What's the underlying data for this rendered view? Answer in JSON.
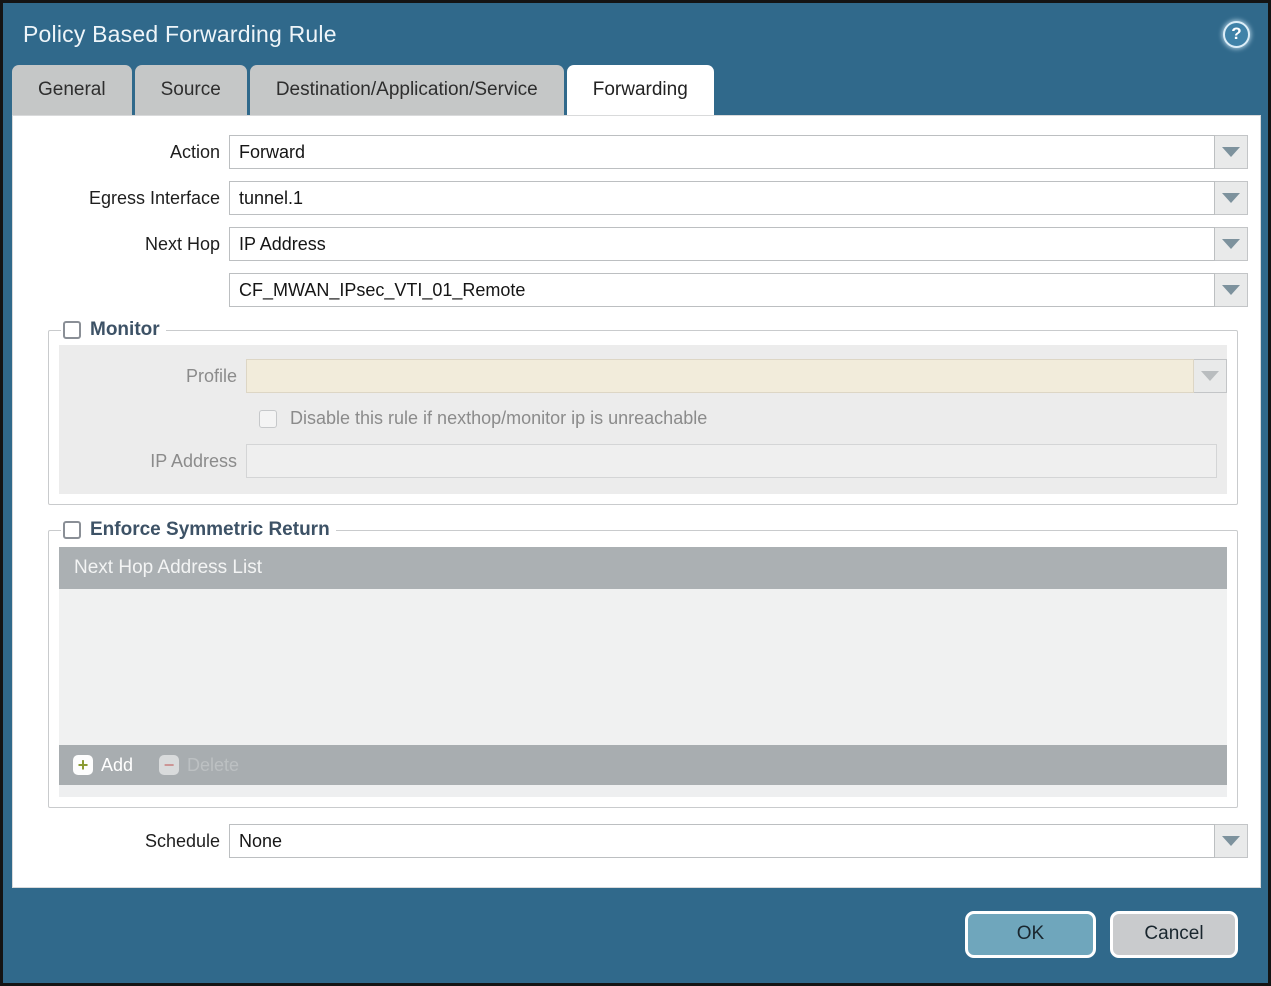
{
  "dialog": {
    "title": "Policy Based Forwarding Rule",
    "help_icon": "?"
  },
  "tabs": [
    {
      "label": "General",
      "active": false
    },
    {
      "label": "Source",
      "active": false
    },
    {
      "label": "Destination/Application/Service",
      "active": false
    },
    {
      "label": "Forwarding",
      "active": true
    }
  ],
  "form": {
    "action": {
      "label": "Action",
      "value": "Forward"
    },
    "egress_interface": {
      "label": "Egress Interface",
      "value": "tunnel.1"
    },
    "next_hop": {
      "label": "Next Hop",
      "value": "IP Address"
    },
    "next_hop_address": {
      "value": "CF_MWAN_IPsec_VTI_01_Remote"
    },
    "schedule": {
      "label": "Schedule",
      "value": "None"
    }
  },
  "monitor": {
    "legend": "Monitor",
    "checked": false,
    "profile": {
      "label": "Profile",
      "value": ""
    },
    "disable_rule_checkbox": {
      "label": "Disable this rule if nexthop/monitor ip is unreachable",
      "checked": false
    },
    "ip_address": {
      "label": "IP Address",
      "value": ""
    }
  },
  "enforce_symmetric_return": {
    "legend": "Enforce Symmetric Return",
    "checked": false,
    "table": {
      "header": "Next Hop Address List",
      "rows": []
    },
    "add_label": "Add",
    "delete_label": "Delete",
    "add_icon": "+",
    "delete_icon": "−"
  },
  "footer": {
    "ok_label": "OK",
    "cancel_label": "Cancel"
  },
  "colors": {
    "titlebar": "#30698B",
    "tab_inactive": "#C5C7C7",
    "tab_active": "#FFFFFF",
    "legend_text": "#3D5266",
    "profile_field": "#F2ECDB",
    "table_header": "#ABB0B3",
    "table_footer": "#A8ADB0",
    "ok_button": "#6FA6BC",
    "cancel_button": "#C9CBCD",
    "add_plus": "#8B9B33"
  }
}
